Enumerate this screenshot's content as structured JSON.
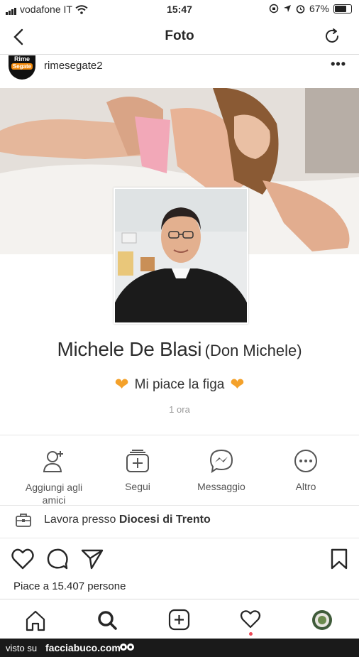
{
  "status_bar": {
    "carrier": "vodafone IT",
    "time": "15:47",
    "battery": "67%",
    "battery_level": 0.67
  },
  "nav": {
    "title": "Foto",
    "back_icon": "chevron-left-icon",
    "refresh_icon": "refresh-icon"
  },
  "post": {
    "avatar_line1": "Rime",
    "avatar_line2": "Segate",
    "username": "rimesegate2",
    "more_icon": "more-dots-icon"
  },
  "profile": {
    "name": "Michele De Blasi",
    "nickname": "(Don Michele)",
    "bio": "Mi piace la figa",
    "time_ago": "1 ora",
    "actions": [
      {
        "label": "Aggiungi agli amici",
        "icon": "add-friend-icon"
      },
      {
        "label": "Segui",
        "icon": "follow-icon"
      },
      {
        "label": "Messaggio",
        "icon": "messenger-icon"
      },
      {
        "label": "Altro",
        "icon": "more-icon"
      }
    ],
    "work_prefix": "Lavora presso",
    "work_place": "Diocesi di Trento"
  },
  "post_footer": {
    "likes_text": "Piace a 15.407 persone"
  },
  "tabbar": {
    "items": [
      "home-icon",
      "search-icon",
      "new-post-icon",
      "activity-icon",
      "profile-icon"
    ]
  },
  "watermark": {
    "prefix": "visto su",
    "site": "facciabuco.com"
  },
  "colors": {
    "accent_heart": "#f4a12a",
    "notification_dot": "#ed4956"
  }
}
